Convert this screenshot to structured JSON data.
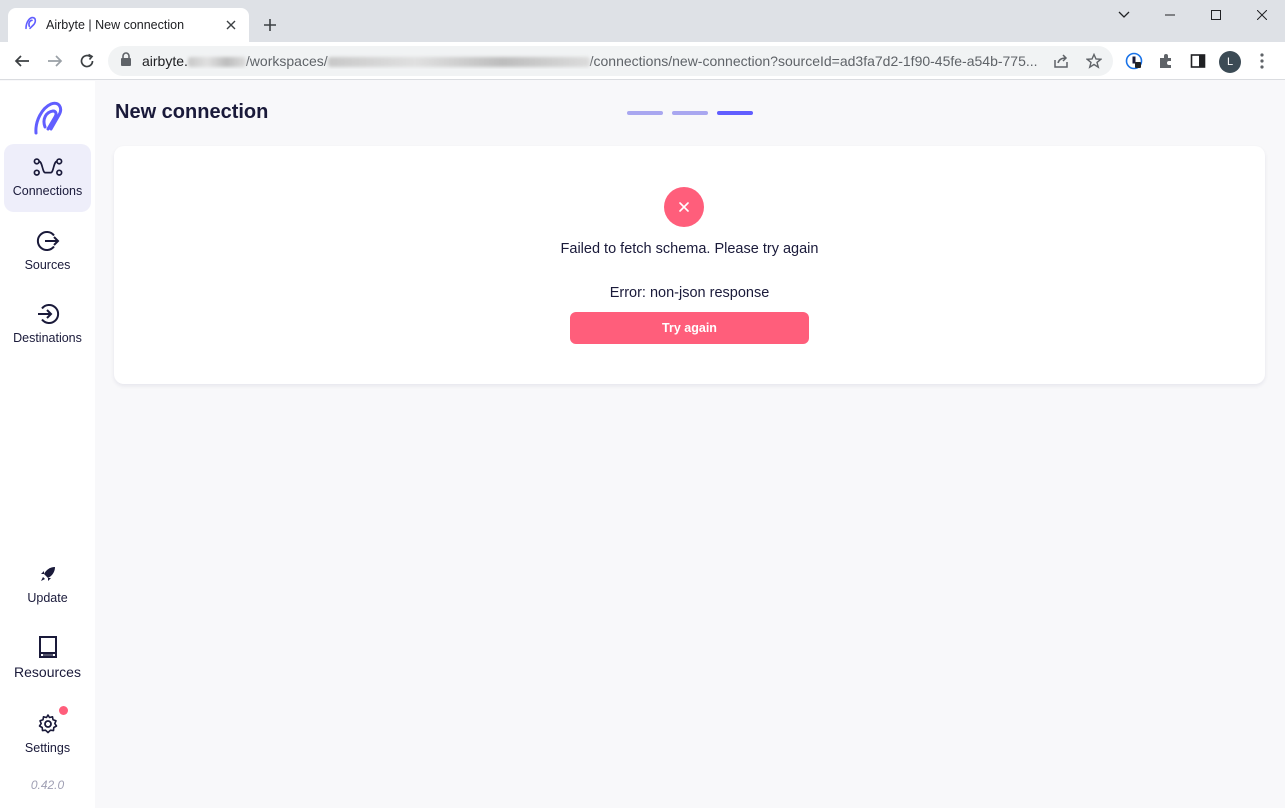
{
  "browser": {
    "tab_title": "Airbyte | New connection",
    "url_host": "airbyte.",
    "url_path_1": "/workspaces/",
    "url_path_2": "/connections/new-connection?sourceId=ad3fa7d2-1f90-45fe-a54b-775...",
    "profile_initial": "L"
  },
  "sidebar": {
    "items": [
      {
        "label": "Connections",
        "icon": "connections-icon",
        "active": true
      },
      {
        "label": "Sources",
        "icon": "sources-icon"
      },
      {
        "label": "Destinations",
        "icon": "destinations-icon"
      }
    ],
    "bottom_items": [
      {
        "label": "Update",
        "icon": "rocket-icon"
      },
      {
        "label": "Resources",
        "icon": "book-icon"
      },
      {
        "label": "Settings",
        "icon": "gear-icon"
      }
    ],
    "version": "0.42.0"
  },
  "main": {
    "title": "New connection",
    "steps": [
      {
        "state": "done"
      },
      {
        "state": "done"
      },
      {
        "state": "current"
      }
    ],
    "error": {
      "message": "Failed to fetch schema. Please try again",
      "detail": "Error: non-json response",
      "button_label": "Try again"
    }
  },
  "colors": {
    "accent": "#615eff",
    "step_done": "#a9a7f0",
    "error": "#ff5e7b",
    "text": "#1a1a3a"
  }
}
